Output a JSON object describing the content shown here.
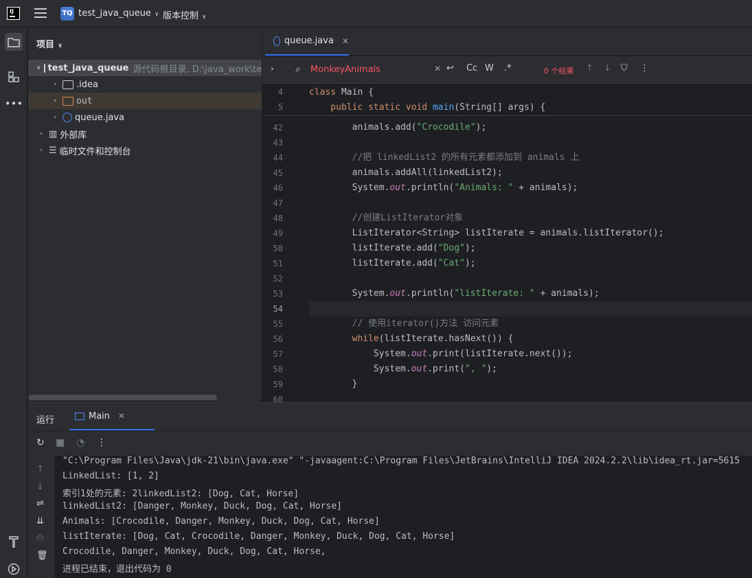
{
  "app": {
    "logo_text": "IJ"
  },
  "titlebar": {
    "project_badge": "TQ",
    "project_name": "test_java_queue",
    "vcs_label": "版本控制"
  },
  "toolstrip": {
    "icons": [
      "folder-icon",
      "structure-icon",
      "more-icon",
      "build-icon",
      "run-icon"
    ]
  },
  "project_panel": {
    "header": "项目",
    "tree": [
      {
        "label": "test_java_queue",
        "hint": "源代码根目录, D:\\java_work\\test_",
        "icon": "folder"
      },
      {
        "label": ".idea",
        "icon": "folder"
      },
      {
        "label": "out",
        "icon": "folder-orange"
      },
      {
        "label": "queue.java",
        "icon": "java"
      },
      {
        "label": "外部库",
        "icon": "library"
      },
      {
        "label": "临时文件和控制台",
        "icon": "scratch"
      }
    ]
  },
  "editor": {
    "tab_label": "queue.java",
    "search": {
      "value": "MonkeyAnimals",
      "result": "0 个结果",
      "match_case": "Cc",
      "whole_word": "W",
      "regex": ".*"
    },
    "sticky_lines": [
      {
        "num": "4",
        "code": "class Main {"
      },
      {
        "num": "5",
        "code": "    public static void main(String[] args) {"
      }
    ],
    "lines": [
      {
        "num": "42",
        "code": "        animals.add(\"Crocodile\");"
      },
      {
        "num": "43",
        "code": ""
      },
      {
        "num": "44",
        "code": "        //把 linkedList2 的所有元素都添加到 animals 上"
      },
      {
        "num": "45",
        "code": "        animals.addAll(linkedList2);"
      },
      {
        "num": "46",
        "code": "        System.out.println(\"Animals: \" + animals);"
      },
      {
        "num": "47",
        "code": ""
      },
      {
        "num": "48",
        "code": "        //创建ListIterator对象"
      },
      {
        "num": "49",
        "code": "        ListIterator<String> listIterate = animals.listIterator();"
      },
      {
        "num": "50",
        "code": "        listIterate.add(\"Dog\");"
      },
      {
        "num": "51",
        "code": "        listIterate.add(\"Cat\");"
      },
      {
        "num": "52",
        "code": ""
      },
      {
        "num": "53",
        "code": "        System.out.println(\"listIterate: \" + animals);"
      },
      {
        "num": "54",
        "code": ""
      },
      {
        "num": "55",
        "code": "        // 使用iterator()方法 访问元素"
      },
      {
        "num": "56",
        "code": "        while(listIterate.hasNext()) {"
      },
      {
        "num": "57",
        "code": "            System.out.print(listIterate.next());"
      },
      {
        "num": "58",
        "code": "            System.out.print(\", \");"
      },
      {
        "num": "59",
        "code": "        }"
      },
      {
        "num": "60",
        "code": ""
      }
    ]
  },
  "run_panel": {
    "title": "运行",
    "tab_label": "Main",
    "console": [
      "\"C:\\Program Files\\Java\\jdk-21\\bin\\java.exe\" \"-javaagent:C:\\Program Files\\JetBrains\\IntelliJ IDEA 2024.2.2\\lib\\idea_rt.jar=5615",
      "LinkedList: [1, 2]",
      "索引1处的元素: 2linkedList2: [Dog, Cat, Horse]",
      "linkedList2: [Danger, Monkey, Duck, Dog, Cat, Horse]",
      "Animals: [Crocodile, Danger, Monkey, Duck, Dog, Cat, Horse]",
      "listIterate: [Dog, Cat, Crocodile, Danger, Monkey, Duck, Dog, Cat, Horse]",
      "Crocodile, Danger, Monkey, Duck, Dog, Cat, Horse,",
      "进程已结束，退出代码为 0"
    ]
  }
}
